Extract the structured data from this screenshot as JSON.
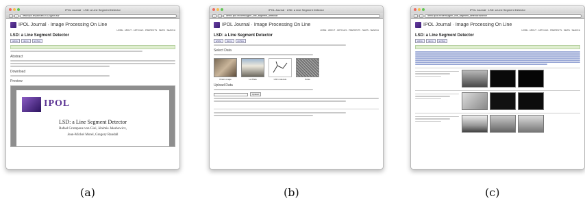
{
  "panels": {
    "a": {
      "window_title": "IPOL Journal · LSD: a Line Segment Detector",
      "url": "www.ipol.im/pub/art/2012/gjmr-lsd/",
      "site_name": "IPOL Journal · Image Processing On Line",
      "nav": "HOME · ABOUT · ARTICLES · PREPRINTS · NEWS · SEARCH",
      "article_title": "LSD: a Line Segment Detector",
      "tabs": [
        "article",
        "demo",
        "archive"
      ],
      "sections": [
        "Abstract",
        "Download",
        "Preview"
      ],
      "pdf": {
        "logo": "IPOL",
        "title": "LSD: a Line Segment Detector",
        "authors_line1": "Rafael Grompone von Gioi, Jérémie Jakubowicz,",
        "authors_line2": "Jean-Michel Morel, Gregory Randall"
      }
    },
    "b": {
      "window_title": "IPOL Journal · LSD: a Line Segment Detector",
      "url": "demo.ipol.im/demo/gjmr_line_segment_detector/",
      "site_name": "IPOL Journal · Image Processing On Line",
      "nav": "HOME · ABOUT · ARTICLES · PREPRINTS · NEWS · SEARCH",
      "article_title": "LSD: a Line Segment Detector",
      "tabs": [
        "article",
        "demo",
        "archive"
      ],
      "sections": [
        "Select Data",
        "Upload Data"
      ],
      "thumbs": [
        "Chairs image",
        "La Plata",
        "LSD molecule",
        "Noise"
      ],
      "upload_button": "Upload"
    },
    "c": {
      "window_title": "IPOL Journal · LSD: a Line Segment Detector",
      "url": "demo.ipol.im/demo/gjmr_line_segment_detector/archive",
      "site_name": "IPOL Journal · Image Processing On Line",
      "nav": "HOME · ABOUT · ARTICLES · PREPRINTS · NEWS · SEARCH",
      "article_title": "LSD: a Line Segment Detector",
      "tabs": [
        "article",
        "demo",
        "archive"
      ]
    }
  },
  "captions": [
    "(a)",
    "(b)",
    "(c)"
  ],
  "colors": {
    "ipol_purple": "#5b3393",
    "green_bar": "#dfeecf",
    "link_blue": "#3344aa"
  }
}
